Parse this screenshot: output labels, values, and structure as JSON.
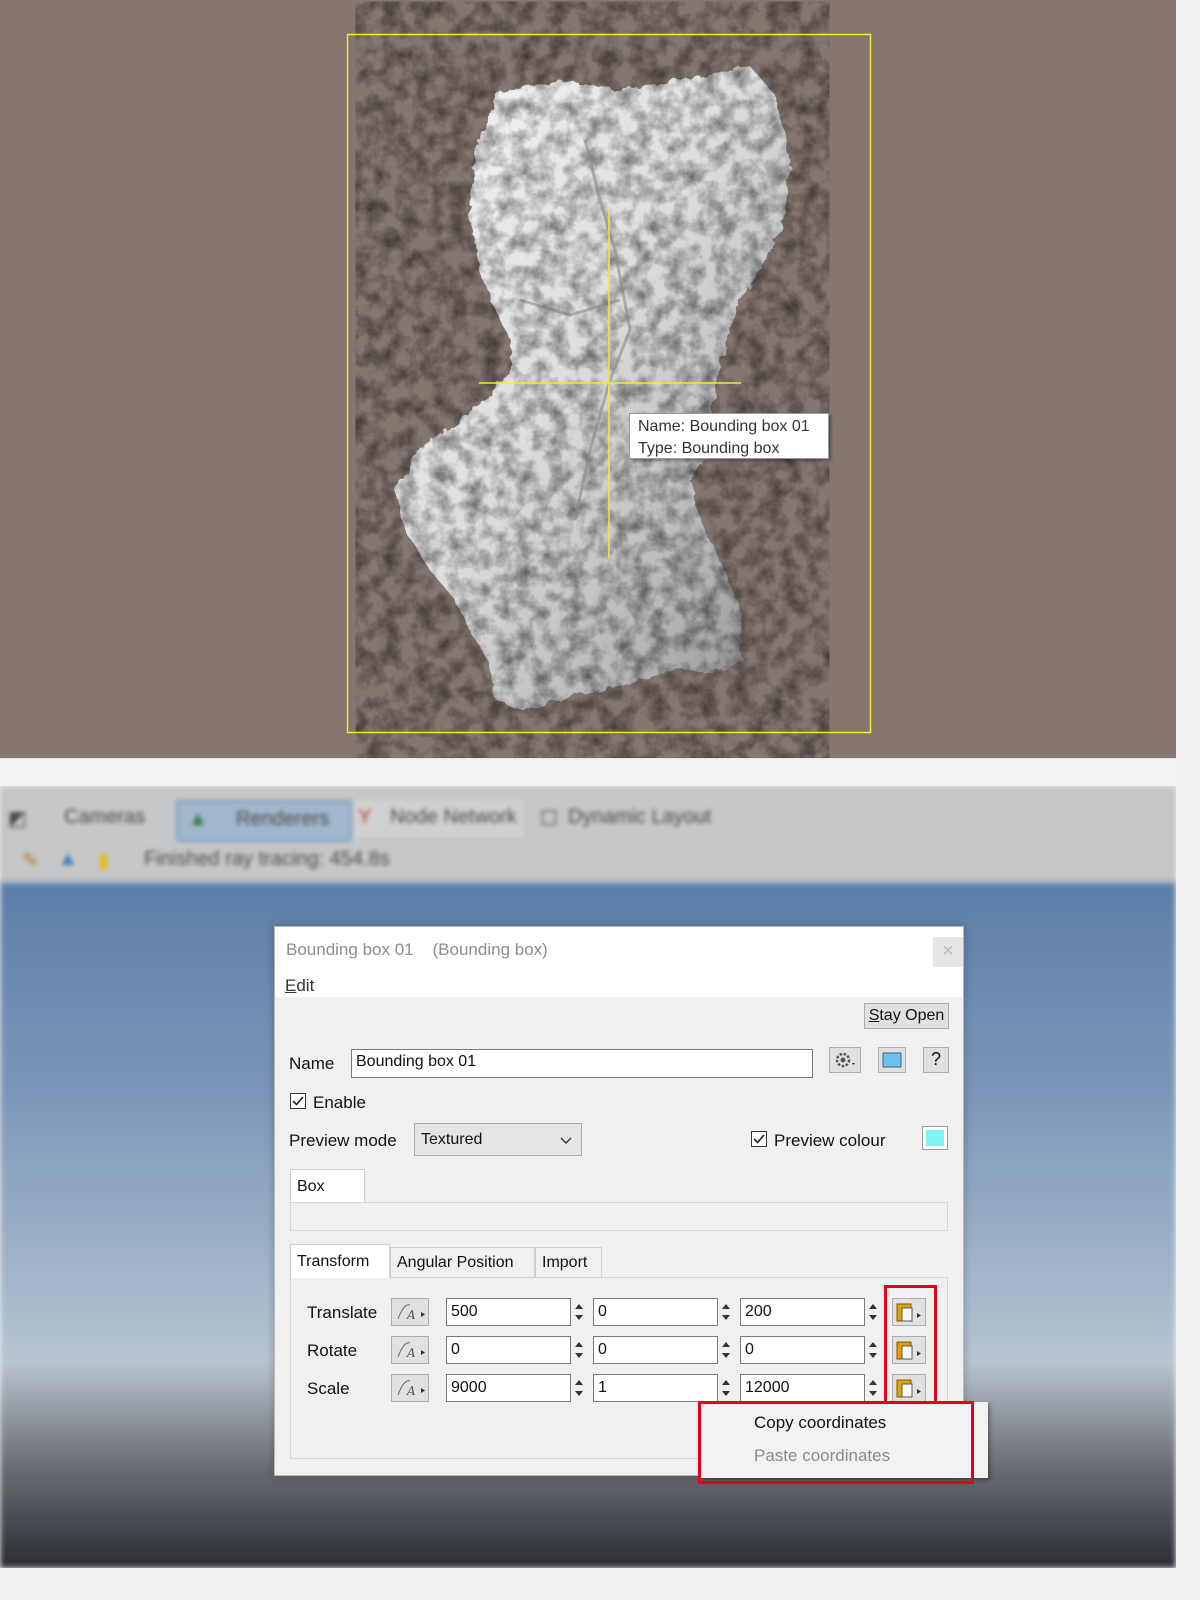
{
  "viewport": {
    "tooltip": {
      "name_line": "Name: Bounding box 01",
      "type_line": "Type: Bounding box"
    },
    "colors": {
      "background": "#857670",
      "bbox": "#ffff00",
      "terrain": "#dcdcdc"
    }
  },
  "toolbar": {
    "tab_cameras": "Cameras",
    "tab_renderers": "Renderers",
    "tab_node_network": "Node Network",
    "tab_dynamic_layout": "Dynamic Layout",
    "status": "Finished ray tracing: 454.8s"
  },
  "dialog": {
    "title": "Bounding box 01",
    "subtitle": "(Bounding box)",
    "close_icon": "close-icon",
    "menu_edit_underlined": "E",
    "menu_edit_rest": "dit",
    "stay_open_underlined": "S",
    "stay_open_rest": "tay Open",
    "name_label": "Name",
    "name_value": "Bounding box 01",
    "enable_label": "Enable",
    "enable_checked": true,
    "preview_mode_label": "Preview mode",
    "preview_mode_value": "Textured",
    "preview_colour_label": "Preview colour",
    "preview_colour_checked": true,
    "preview_colour": "#7ff3f6",
    "group_tab_box": "Box",
    "tabs": [
      "Transform",
      "Angular Position",
      "Import"
    ],
    "rows": [
      {
        "label": "Translate",
        "x": "500",
        "y": "0",
        "z": "200"
      },
      {
        "label": "Rotate",
        "x": "0",
        "y": "0",
        "z": "0"
      },
      {
        "label": "Scale",
        "x": "9000",
        "y": "1",
        "z": "12000"
      }
    ]
  },
  "context_menu": {
    "copy": "Copy coordinates",
    "paste": "Paste coordinates",
    "paste_enabled": false
  },
  "highlight_color": "#e3001b"
}
